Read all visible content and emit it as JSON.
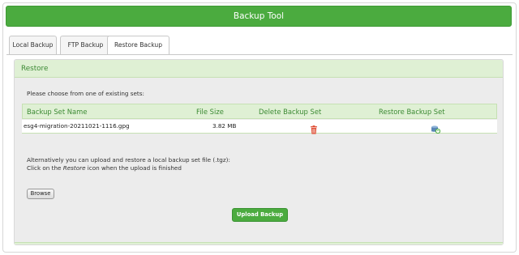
{
  "window": {
    "title": "Backup Tool"
  },
  "tabs": [
    {
      "label": "Local Backup",
      "active": false
    },
    {
      "label": "FTP Backup",
      "active": false
    },
    {
      "label": "Restore Backup",
      "active": true
    }
  ],
  "restore": {
    "heading": "Restore",
    "intro": "Please choose from one of existing sets:",
    "columns": [
      "Backup Set Name",
      "File Size",
      "Delete Backup Set",
      "Restore Backup Set"
    ],
    "rows": [
      {
        "name": "esg4-migration-20211021-1116.gpg",
        "size": "3.82 MB",
        "delete_icon": "trash-icon",
        "restore_icon": "restore-icon"
      }
    ],
    "alt_line1": "Alternatively you can upload and restore a local backup set file (.tgz):",
    "alt_line2_pre": "Click on the ",
    "alt_line2_em": "Restore",
    "alt_line2_post": " icon when the upload is finished",
    "browse_label": "Browse",
    "upload_label": "Upload Backup"
  },
  "colors": {
    "accent": "#4bab3f",
    "header_bg": "#dff0d4",
    "header_text": "#3c8a34",
    "delete": "#e0523a",
    "restore": "#5b87b6"
  }
}
